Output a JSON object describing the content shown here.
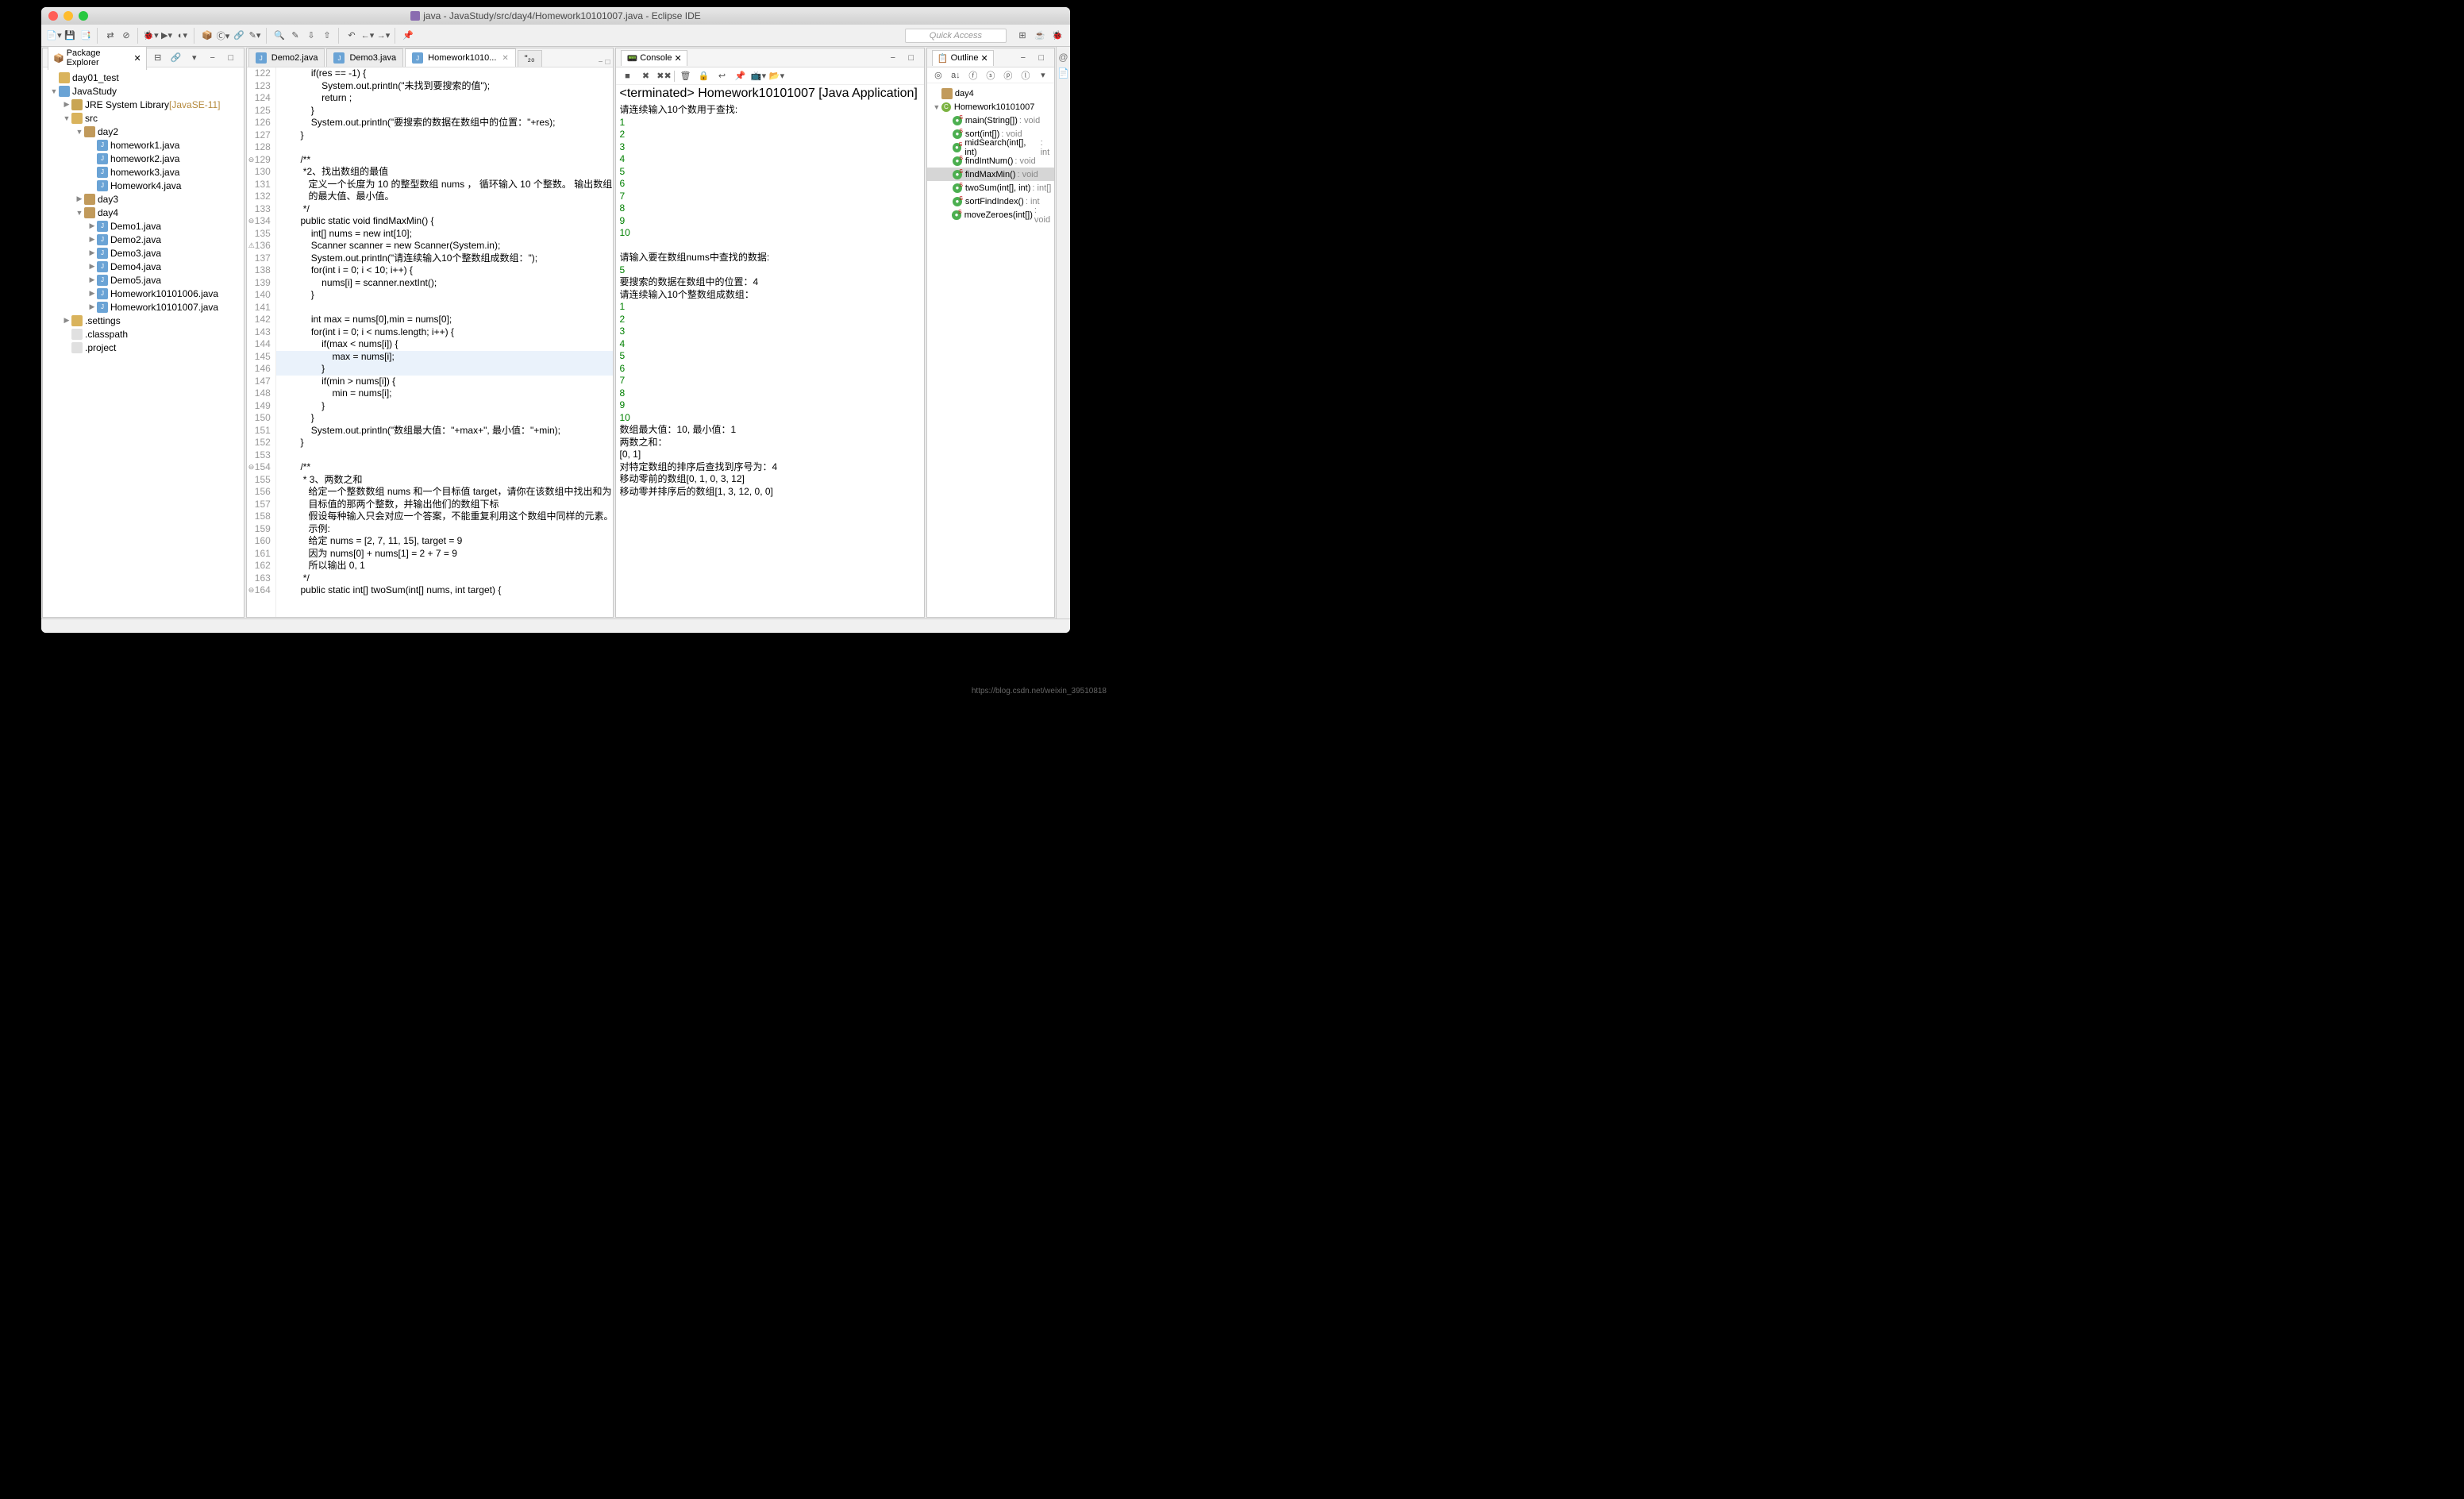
{
  "title": "java - JavaStudy/src/day4/Homework10101007.java - Eclipse IDE",
  "quickAccess": "Quick Access",
  "pkgExplorer": {
    "title": "Package Explorer",
    "nodes": [
      {
        "d": 0,
        "a": "",
        "i": "folder",
        "t": "day01_test"
      },
      {
        "d": 0,
        "a": "▼",
        "i": "proj",
        "t": "JavaStudy"
      },
      {
        "d": 1,
        "a": "▶",
        "i": "lib",
        "t": "JRE System Library",
        "suffix": "[JavaSE-11]"
      },
      {
        "d": 1,
        "a": "▼",
        "i": "folder",
        "t": "src"
      },
      {
        "d": 2,
        "a": "▼",
        "i": "pkg",
        "t": "day2"
      },
      {
        "d": 3,
        "a": "",
        "i": "java",
        "t": "homework1.java"
      },
      {
        "d": 3,
        "a": "",
        "i": "java",
        "t": "homework2.java"
      },
      {
        "d": 3,
        "a": "",
        "i": "java",
        "t": "homework3.java"
      },
      {
        "d": 3,
        "a": "",
        "i": "java",
        "t": "Homework4.java"
      },
      {
        "d": 2,
        "a": "▶",
        "i": "pkg",
        "t": "day3"
      },
      {
        "d": 2,
        "a": "▼",
        "i": "pkg",
        "t": "day4"
      },
      {
        "d": 3,
        "a": "▶",
        "i": "java",
        "t": "Demo1.java"
      },
      {
        "d": 3,
        "a": "▶",
        "i": "java",
        "t": "Demo2.java"
      },
      {
        "d": 3,
        "a": "▶",
        "i": "java",
        "t": "Demo3.java"
      },
      {
        "d": 3,
        "a": "▶",
        "i": "java",
        "t": "Demo4.java"
      },
      {
        "d": 3,
        "a": "▶",
        "i": "java",
        "t": "Demo5.java"
      },
      {
        "d": 3,
        "a": "▶",
        "i": "java",
        "t": "Homework10101006.java"
      },
      {
        "d": 3,
        "a": "▶",
        "i": "java",
        "t": "Homework10101007.java"
      },
      {
        "d": 1,
        "a": "▶",
        "i": "folder",
        "t": ".settings"
      },
      {
        "d": 1,
        "a": "",
        "i": "file",
        "t": ".classpath"
      },
      {
        "d": 1,
        "a": "",
        "i": "file",
        "t": ".project"
      }
    ]
  },
  "editorTabs": [
    {
      "label": "Demo2.java"
    },
    {
      "label": "Demo3.java"
    },
    {
      "label": "Homework1010...",
      "active": true
    },
    {
      "label": "\"₂₀",
      "raw": true
    }
  ],
  "code": [
    {
      "n": 122,
      "h": "\t\t\t<kw>if</kw>(res == -1) {"
    },
    {
      "n": 123,
      "h": "\t\t\t\tSystem.<fld>out</fld>.println(<str>\"未找到要搜索的值\"</str>);"
    },
    {
      "n": 124,
      "h": "\t\t\t\t<kw>return</kw> ;"
    },
    {
      "n": 125,
      "h": "\t\t\t}"
    },
    {
      "n": 126,
      "h": "\t\t\tSystem.<fld>out</fld>.println(<str>\"要搜索的数据在数组中的位置：\"</str>+res);"
    },
    {
      "n": 127,
      "h": "\t\t}"
    },
    {
      "n": 128,
      "h": ""
    },
    {
      "n": 129,
      "m": "⊖",
      "h": "\t\t<com>/**</com>"
    },
    {
      "n": 130,
      "h": "\t\t<com> *2、找出数组的最值</com>"
    },
    {
      "n": 131,
      "h": "\t\t<com>   定义一个长度为 10 的整型数组 <ann>nums</ann> ， 循环输入 10 个整数。 输出数组</com>"
    },
    {
      "n": 132,
      "h": "\t\t<com>   的最大值、最小值。</com>"
    },
    {
      "n": 133,
      "h": "\t\t<com> */</com>"
    },
    {
      "n": 134,
      "m": "⊖",
      "h": "\t\t<kw>public</kw> <kw>static</kw> <kw>void</kw> findMaxMin() {"
    },
    {
      "n": 135,
      "h": "\t\t\t<kw>int</kw>[] nums = <kw>new</kw> <kw>int</kw>[10];"
    },
    {
      "n": 136,
      "m": "⚠",
      "h": "\t\t\tScanner <err>scanner</err> = <kw>new</kw> Scanner(System.<fld>in</fld>);"
    },
    {
      "n": 137,
      "h": "\t\t\tSystem.<fld>out</fld>.println(<str>\"请连续输入10个整数组成数组：\"</str>);"
    },
    {
      "n": 138,
      "h": "\t\t\t<kw>for</kw>(<kw>int</kw> i = 0; i &lt; 10; i++) {"
    },
    {
      "n": 139,
      "h": "\t\t\t\tnums[i] = scanner.nextInt();"
    },
    {
      "n": 140,
      "h": "\t\t\t}"
    },
    {
      "n": 141,
      "h": ""
    },
    {
      "n": 142,
      "h": "\t\t\t<kw>int</kw> max = nums[0],min = nums[0];"
    },
    {
      "n": 143,
      "h": "\t\t\t<kw>for</kw>(<kw>int</kw> i = 0; i &lt; nums.length; i++) {"
    },
    {
      "n": 144,
      "h": "\t\t\t\t<kw>if</kw>(max &lt; nums[i]) {"
    },
    {
      "n": 145,
      "hl": true,
      "h": "\t\t\t\t\tmax = nums[i];"
    },
    {
      "n": 146,
      "hl": true,
      "h": "\t\t\t\t}"
    },
    {
      "n": 147,
      "h": "\t\t\t\t<kw>if</kw>(min &gt; nums[i]) {"
    },
    {
      "n": 148,
      "h": "\t\t\t\t\tmin = nums[i];"
    },
    {
      "n": 149,
      "h": "\t\t\t\t}"
    },
    {
      "n": 150,
      "h": "\t\t\t}"
    },
    {
      "n": 151,
      "h": "\t\t\tSystem.<fld>out</fld>.println(<str>\"数组最大值：\"</str>+max+<str>\", 最小值：\"</str>+min);"
    },
    {
      "n": 152,
      "h": "\t\t}"
    },
    {
      "n": 153,
      "h": ""
    },
    {
      "n": 154,
      "m": "⊖",
      "h": "\t\t<com>/**</com>"
    },
    {
      "n": 155,
      "h": "\t\t<com> * 3、两数之和</com>"
    },
    {
      "n": 156,
      "h": "\t\t<com>   给定一个整数数组 <ann>nums</ann> 和一个目标值 target，请你在该数组中找出和为</com>"
    },
    {
      "n": 157,
      "h": "\t\t<com>   目标值的那两个整数，并输出他们的数组下标</com>"
    },
    {
      "n": 158,
      "h": "\t\t<com>   假设每种输入只会对应一个答案，不能重复利用这个数组中同样的元素。</com>"
    },
    {
      "n": 159,
      "h": "\t\t<com>   示例:</com>"
    },
    {
      "n": 160,
      "h": "\t\t<com>   给定 <ann>nums</ann> = [2, 7, 11, 15], target = 9</com>"
    },
    {
      "n": 161,
      "h": "\t\t<com>   因为 <ann>nums</ann>[0] + <ann>nums</ann>[1] = 2 + 7 = 9</com>"
    },
    {
      "n": 162,
      "h": "\t\t<com>   所以输出 0, 1</com>"
    },
    {
      "n": 163,
      "h": "\t\t<com> */</com>"
    },
    {
      "n": 164,
      "m": "⊖",
      "h": "\t\t<kw>public</kw> <kw>static</kw> <kw>int</kw>[] twoSum(<kw>int</kw>[] nums, <kw>int</kw> target) {"
    }
  ],
  "console": {
    "title": "Console",
    "status": "<terminated> Homework10101007 [Java Application]",
    "lines": [
      {
        "t": "请连续输入10个数用于查找:"
      },
      {
        "t": "1",
        "in": true
      },
      {
        "t": "2",
        "in": true
      },
      {
        "t": "3",
        "in": true
      },
      {
        "t": "4",
        "in": true
      },
      {
        "t": "5",
        "in": true
      },
      {
        "t": "6",
        "in": true
      },
      {
        "t": "7",
        "in": true
      },
      {
        "t": "8",
        "in": true
      },
      {
        "t": "9",
        "in": true
      },
      {
        "t": "10",
        "in": true
      },
      {
        "t": ""
      },
      {
        "t": "请输入要在数组nums中查找的数据:"
      },
      {
        "t": "5",
        "in": true
      },
      {
        "t": "要搜索的数据在数组中的位置：4"
      },
      {
        "t": "请连续输入10个整数组成数组："
      },
      {
        "t": "1",
        "in": true
      },
      {
        "t": "2",
        "in": true
      },
      {
        "t": "3",
        "in": true
      },
      {
        "t": "4",
        "in": true
      },
      {
        "t": "5",
        "in": true
      },
      {
        "t": "6",
        "in": true
      },
      {
        "t": "7",
        "in": true
      },
      {
        "t": "8",
        "in": true
      },
      {
        "t": "9",
        "in": true
      },
      {
        "t": "10",
        "in": true
      },
      {
        "t": "数组最大值：10, 最小值：1"
      },
      {
        "t": "两数之和："
      },
      {
        "t": "[0, 1]"
      },
      {
        "t": "对特定数组的排序后查找到序号为：4"
      },
      {
        "t": "移动零前的数组[0, 1, 0, 3, 12]"
      },
      {
        "t": "移动零并排序后的数组[1, 3, 12, 0, 0]"
      }
    ]
  },
  "outline": {
    "title": "Outline",
    "nodes": [
      {
        "d": 0,
        "i": "pkg",
        "t": "day4"
      },
      {
        "d": 0,
        "a": "▼",
        "i": "cls",
        "t": "Homework10101007"
      },
      {
        "d": 1,
        "i": "meth",
        "s": "S",
        "t": "main(String[])",
        "r": ": void"
      },
      {
        "d": 1,
        "i": "meth",
        "s": "S",
        "t": "sort(int[])",
        "r": ": void"
      },
      {
        "d": 1,
        "i": "meth",
        "s": "S",
        "t": "midSearch(int[], int)",
        "r": ": int"
      },
      {
        "d": 1,
        "i": "meth",
        "s": "S",
        "t": "findIntNum()",
        "r": ": void"
      },
      {
        "d": 1,
        "i": "meth",
        "s": "S",
        "t": "findMaxMin()",
        "r": ": void",
        "sel": true
      },
      {
        "d": 1,
        "i": "meth",
        "s": "S",
        "t": "twoSum(int[], int)",
        "r": ": int[]"
      },
      {
        "d": 1,
        "i": "meth",
        "s": "S",
        "t": "sortFindIndex()",
        "r": ": int"
      },
      {
        "d": 1,
        "i": "meth",
        "s": "S",
        "t": "moveZeroes(int[])",
        "r": ": void"
      }
    ]
  },
  "watermark": "https://blog.csdn.net/weixin_39510818"
}
